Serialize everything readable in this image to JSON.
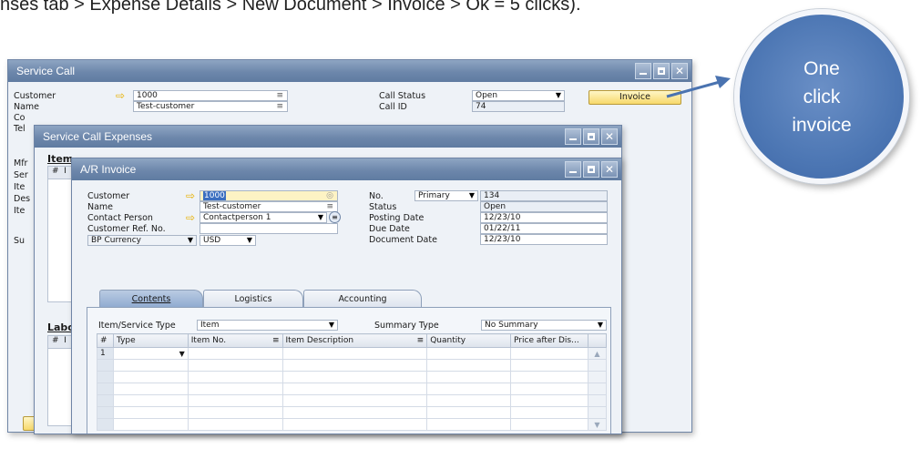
{
  "caption": "nses tab > Expense Details > New Document > Invoice > Ok = 5 clicks).",
  "callout": {
    "line1": "One",
    "line2": "click",
    "line3": "invoice"
  },
  "service_call": {
    "title": "Service Call",
    "labels": {
      "customer": "Customer",
      "name": "Name",
      "co": "Co",
      "tel": "Tel",
      "mfr": "Mfr",
      "ser": "Ser",
      "ite1": "Ite",
      "des": "Des",
      "ite2": "Ite",
      "su": "Su"
    },
    "customer": "1000",
    "name": "Test-customer",
    "call_status_label": "Call Status",
    "call_status": "Open",
    "call_id_label": "Call ID",
    "call_id": "74",
    "invoice_button": "Invoice"
  },
  "expenses": {
    "title": "Service Call Expenses",
    "items_label": "Item",
    "labor_label": "Labo",
    "hash": "#",
    "col_i": "I"
  },
  "invoice": {
    "title": "A/R Invoice",
    "labels": {
      "customer": "Customer",
      "name": "Name",
      "contact_person": "Contact Person",
      "customer_ref": "Customer Ref. No.",
      "bp_currency": "BP Currency",
      "no": "No.",
      "status": "Status",
      "posting_date": "Posting Date",
      "due_date": "Due Date",
      "document_date": "Document Date"
    },
    "customer": "1000",
    "name": "Test-customer",
    "contact_person": "Contactperson 1",
    "customer_ref": "",
    "currency": "USD",
    "series": "Primary",
    "number": "134",
    "status": "Open",
    "posting_date": "12/23/10",
    "due_date": "01/22/11",
    "document_date": "12/23/10",
    "tabs": [
      "Contents",
      "Logistics",
      "Accounting"
    ],
    "item_service_type_label": "Item/Service Type",
    "item_service_type": "Item",
    "summary_type_label": "Summary Type",
    "summary_type": "No Summary",
    "columns": [
      "#",
      "Type",
      "Item No.",
      "Item Description",
      "Quantity",
      "Price after Dis..."
    ],
    "first_row_number": "1"
  }
}
